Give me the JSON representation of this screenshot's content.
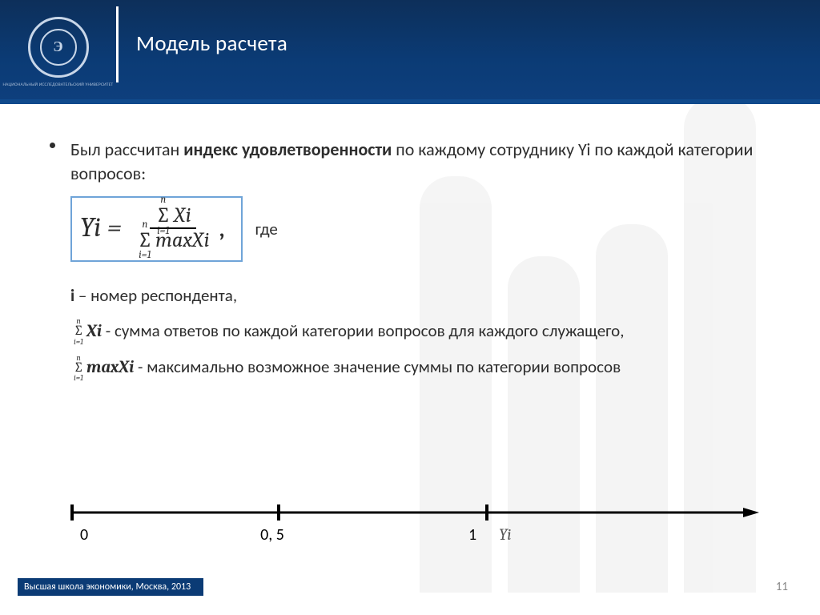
{
  "header": {
    "title": "Модель расчета",
    "logo_mark": "Э",
    "logo_caption": "НАЦИОНАЛЬНЫЙ ИССЛЕДОВАТЕЛЬСКИЙ УНИВЕРСИТЕТ"
  },
  "body": {
    "intro_pre": "Был рассчитан ",
    "intro_bold": "индекс удовлетворенности",
    "intro_post": " по каждому сотруднику Yi по каждой категории вопросов:",
    "formula": {
      "lhs": "Yi =",
      "sum_upper": "n",
      "sum_lower": "i=1",
      "num_var": "Xi",
      "den_var": "maxXi"
    },
    "gde": "где",
    "def_i_bold": "i",
    "def_i_text": " – номер респондента,",
    "def_sum_text": "  -  сумма ответов по каждой категории вопросов для каждого служащего,",
    "def_max_text": "  -  максимально возможное значение суммы по категории вопросов"
  },
  "axis": {
    "tick0": "0",
    "tick1": "0, 5",
    "tick2": "1",
    "var": "Yi"
  },
  "footer": {
    "left": "Высшая школа экономики, Москва, 2013",
    "page": "11"
  }
}
